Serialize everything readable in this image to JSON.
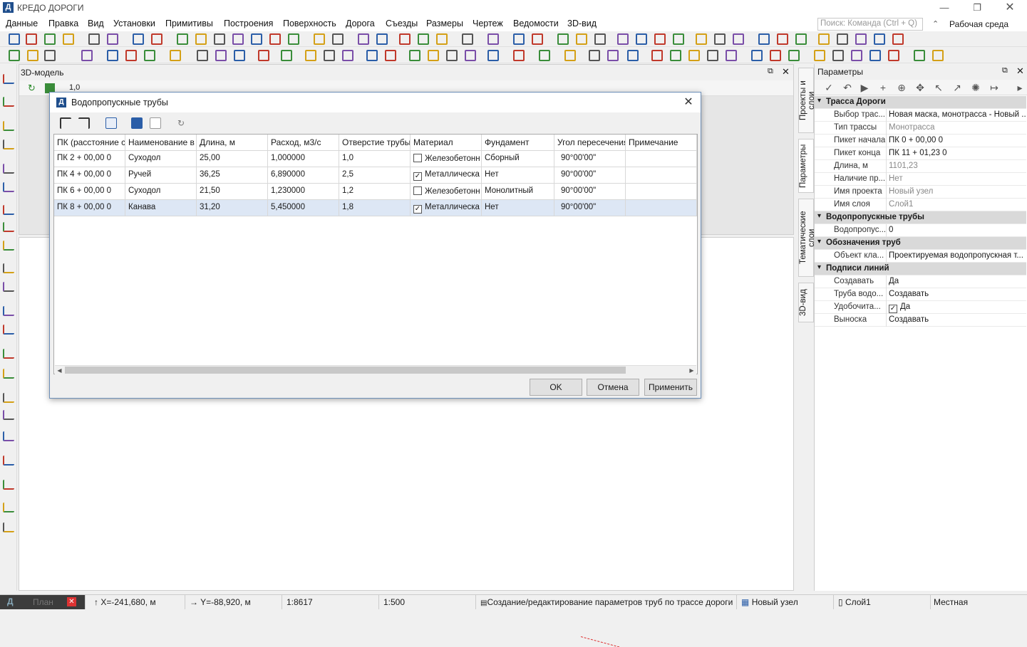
{
  "window": {
    "title": "КРЕДО ДОРОГИ",
    "logo_letter": "Д"
  },
  "menu": [
    "Данные",
    "Правка",
    "Вид",
    "Установки",
    "Примитивы",
    "Построения",
    "Поверхность",
    "Дорога",
    "Съезды",
    "Размеры",
    "Чертеж",
    "Ведомости",
    "3D-вид"
  ],
  "search": {
    "placeholder": "Поиск: Команда (Ctrl + Q)"
  },
  "workspace": "Рабочая среда",
  "view3d": {
    "title": "3D-модель",
    "scale_value": "1,0"
  },
  "side_tabs": [
    "Проекты и слои",
    "Параметры",
    "Тематические слои",
    "3D-вид"
  ],
  "params": {
    "title": "Параметры",
    "groups": [
      {
        "name": "Трасса Дороги",
        "rows": [
          {
            "label": "Выбор трас...",
            "value": "Новая маска, монотрасса - Новый ..."
          },
          {
            "label": "Тип трассы",
            "value": "Монотрасса",
            "grey": true
          },
          {
            "label": "Пикет начала",
            "value": "ПК    0 + 00,00  0"
          },
          {
            "label": "Пикет конца",
            "value": "ПК    11 + 01,23  0"
          },
          {
            "label": "Длина, м",
            "value": "1101,23",
            "grey": true
          },
          {
            "label": "Наличие пр...",
            "value": "Нет",
            "grey": true
          },
          {
            "label": "Имя проекта",
            "value": "Новый узел",
            "grey": true
          },
          {
            "label": "Имя слоя",
            "value": "Слой1",
            "grey": true
          }
        ]
      },
      {
        "name": "Водопропускные трубы",
        "rows": [
          {
            "label": "Водопропус...",
            "value": "0"
          }
        ]
      },
      {
        "name": "Обозначения труб",
        "rows": [
          {
            "label": "Объект кла...",
            "value": "Проектируемая водопропускная т..."
          }
        ]
      },
      {
        "name": "Подписи линий",
        "rows": [
          {
            "label": "Создавать",
            "value": "Да"
          },
          {
            "label": "Труба водо...",
            "value": "Создавать"
          },
          {
            "label": "Удобочита...",
            "value": "Да",
            "checkbox": true
          },
          {
            "label": "Выноска",
            "value": "Создавать"
          }
        ]
      }
    ]
  },
  "dialog": {
    "title": "Водопропускные трубы",
    "columns": [
      "ПК (расстояние с",
      "Наименование в",
      "Длина, м",
      "Расход, м3/с",
      "Отверстие трубы",
      "Материал",
      "Фундамент",
      "Угол пересечения",
      "Примечание"
    ],
    "rows": [
      {
        "pk": "ПК     2 + 00,00  0",
        "name": "Суходол",
        "length": "25,00",
        "flow": "1,000000",
        "hole": "1,0",
        "checked": false,
        "material": "Железобетонн",
        "foundation": "Сборный",
        "angle": "90°00'00\"",
        "note": ""
      },
      {
        "pk": "ПК     4 + 00,00  0",
        "name": "Ручей",
        "length": "36,25",
        "flow": "6,890000",
        "hole": "2,5",
        "checked": true,
        "material": "Металлическа",
        "foundation": "Нет",
        "angle": "90°00'00\"",
        "note": ""
      },
      {
        "pk": "ПК     6 + 00,00  0",
        "name": "Суходол",
        "length": "21,50",
        "flow": "1,230000",
        "hole": "1,2",
        "checked": false,
        "material": "Железобетонн",
        "foundation": "Монолитный",
        "angle": "90°00'00\"",
        "note": ""
      },
      {
        "pk": "ПК     8 + 00,00  0",
        "name": "Канава",
        "length": "31,20",
        "flow": "5,450000",
        "hole": "1,8",
        "checked": true,
        "material": "Металлическа",
        "foundation": "Нет",
        "angle": "90°00'00\"",
        "note": ""
      }
    ],
    "buttons": {
      "ok": "OK",
      "cancel": "Отмена",
      "apply": "Применить"
    }
  },
  "status": {
    "task": "План",
    "x": "X=-241,680, м",
    "y": "Y=-88,920, м",
    "scale1": "1:8617",
    "scale2": "1:500",
    "message": "Создание/редактирование параметров труб по трассе дороги",
    "project": "Новый узел",
    "layer": "Слой1",
    "coord_sys": "Местная"
  },
  "colors": {
    "accent": "#1f4e8c",
    "selection": "#dde7f5",
    "group_bg": "#d9d9d9"
  }
}
